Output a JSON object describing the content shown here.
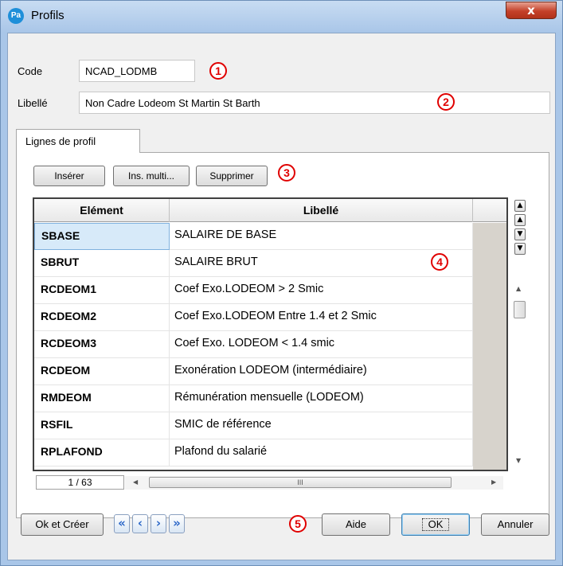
{
  "window": {
    "title": "Profils",
    "app_icon": "Pa",
    "close_label": "x"
  },
  "fields": {
    "code_label": "Code",
    "code_value": "NCAD_LODMB",
    "libelle_label": "Libellé",
    "libelle_value": "Non Cadre Lodeom St Martin St Barth"
  },
  "tabs": [
    {
      "label": "Lignes de profil",
      "active": true
    }
  ],
  "toolbar": {
    "inserer_label": "Insérer",
    "ins_multi_label": "Ins. multi...",
    "supprimer_label": "Supprimer"
  },
  "grid": {
    "columns": [
      "Elément",
      "Libellé"
    ],
    "rows": [
      {
        "code": "SBASE",
        "label": "SALAIRE DE BASE",
        "selected": true
      },
      {
        "code": "SBRUT",
        "label": "SALAIRE BRUT"
      },
      {
        "code": "RCDEOM1",
        "label": "Coef Exo.LODEOM > 2 Smic"
      },
      {
        "code": "RCDEOM2",
        "label": "Coef Exo.LODEOM Entre 1.4 et 2 Smic"
      },
      {
        "code": "RCDEOM3",
        "label": "Coef Exo. LODEOM < 1.4 smic"
      },
      {
        "code": "RCDEOM",
        "label": "Exonération LODEOM (intermédiaire)"
      },
      {
        "code": "RMDEOM",
        "label": "Rémunération mensuelle (LODEOM)"
      },
      {
        "code": "RSFIL",
        "label": "SMIC de référence"
      },
      {
        "code": "RPLAFOND",
        "label": "Plafond du salarié"
      }
    ],
    "pager": "1 / 63",
    "hscroll_grip": "III"
  },
  "footer": {
    "ok_creer_label": "Ok et Créer",
    "aide_label": "Aide",
    "ok_label": "OK",
    "annuler_label": "Annuler"
  },
  "annotations": [
    "1",
    "2",
    "3",
    "4",
    "5"
  ],
  "colors": {
    "annotation": "#e00000",
    "title_bar": "#a9c6e8",
    "selected_cell": "#d7eaf9",
    "nav_arrow": "#2a66c8"
  }
}
